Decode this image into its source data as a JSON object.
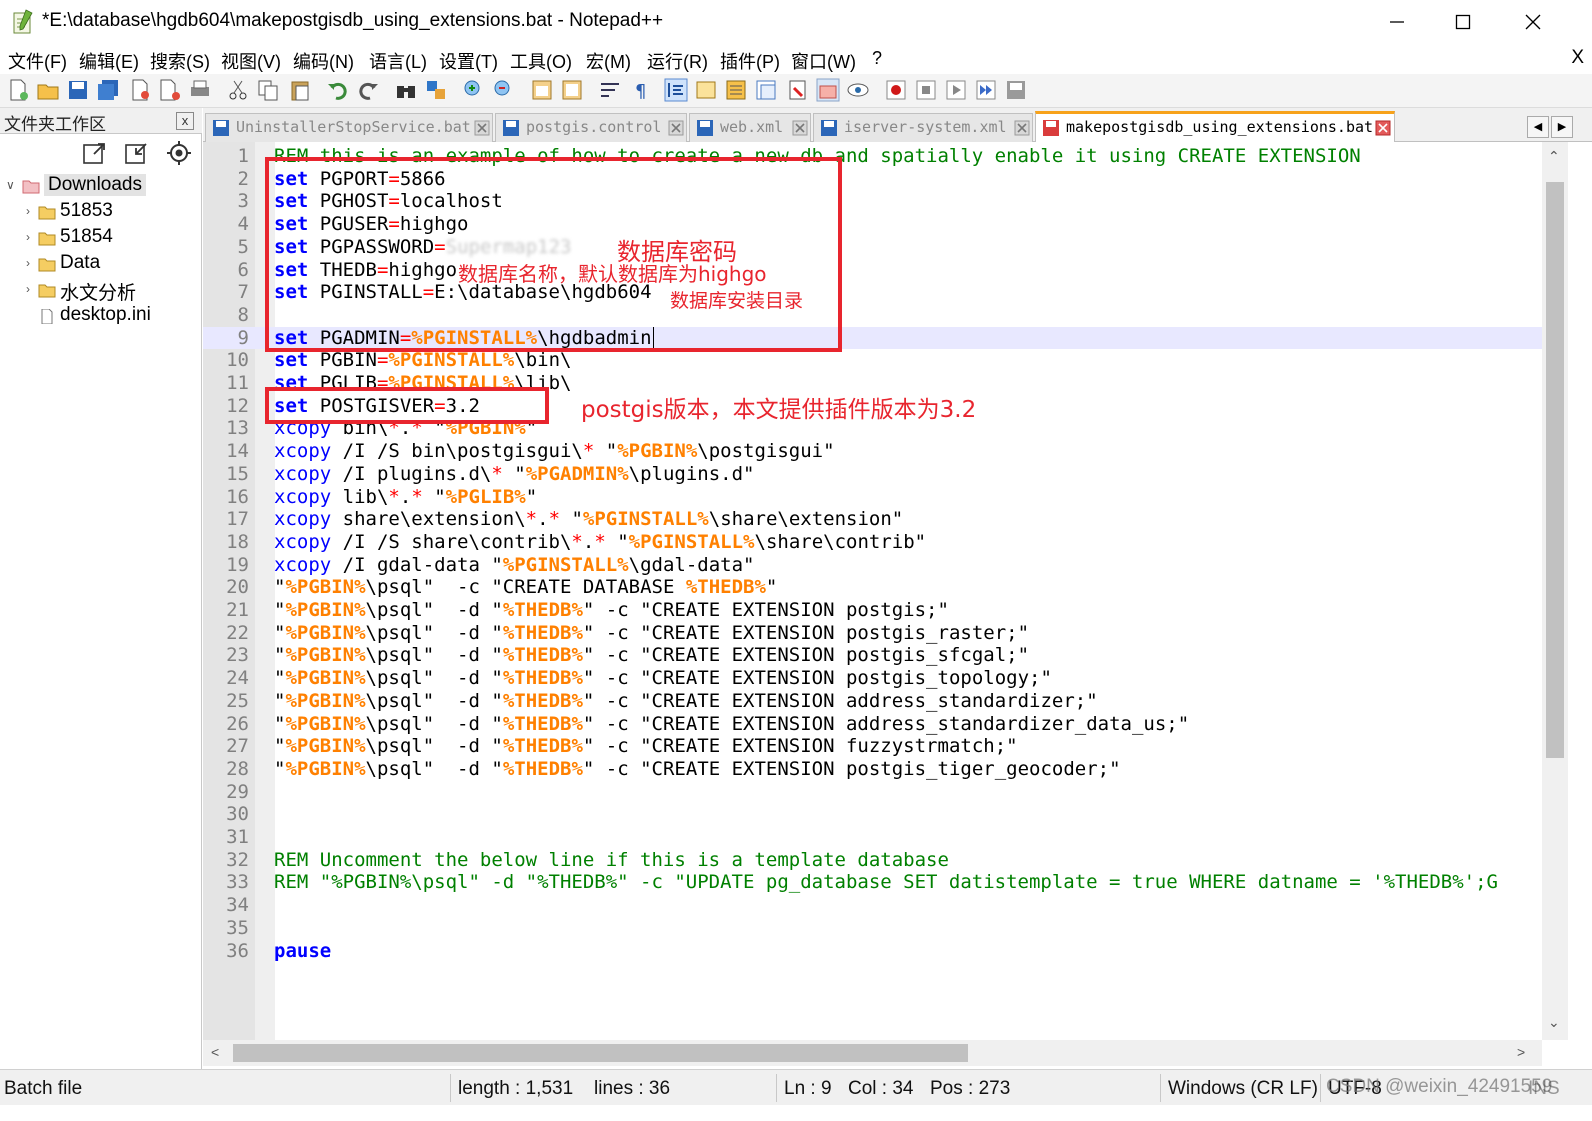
{
  "window": {
    "title": "*E:\\database\\hgdb604\\makepostgisdb_using_extensions.bat - Notepad++",
    "min_icon": "minimize-icon",
    "max_icon": "maximize-icon",
    "close_icon": "close-icon"
  },
  "menu": {
    "items": [
      "文件(F)",
      "编辑(E)",
      "搜索(S)",
      "视图(V)",
      "编码(N)",
      "语言(L)",
      "设置(T)",
      "工具(O)",
      "宏(M)",
      "运行(R)",
      "插件(P)",
      "窗口(W)",
      "?"
    ],
    "close_label": "X"
  },
  "panel": {
    "title": "文件夹工作区",
    "close_label": "x",
    "tree": [
      {
        "label": "Downloads",
        "kind": "root"
      },
      {
        "label": "51853",
        "kind": "folder"
      },
      {
        "label": "51854",
        "kind": "folder"
      },
      {
        "label": "Data",
        "kind": "folder"
      },
      {
        "label": "水文分析",
        "kind": "folder"
      },
      {
        "label": "desktop.ini",
        "kind": "file"
      }
    ]
  },
  "tabs": [
    {
      "label": "UninstallerStopService.bat",
      "active": false
    },
    {
      "label": "postgis.control",
      "active": false
    },
    {
      "label": "web.xml",
      "active": false
    },
    {
      "label": "iserver-system.xml",
      "active": false
    },
    {
      "label": "makepostgisdb_using_extensions.bat",
      "active": true
    }
  ],
  "editor": {
    "current_line": 9,
    "lines": [
      {
        "n": "1",
        "segs": [
          [
            "c",
            "REM this is an example of how to create a new db and spatially enable it using CREATE EXTENSION"
          ]
        ]
      },
      {
        "n": "2",
        "segs": [
          [
            "k",
            "set"
          ],
          [
            "d",
            " PGPORT"
          ],
          [
            "op",
            "="
          ],
          [
            "d",
            "5866"
          ]
        ]
      },
      {
        "n": "3",
        "segs": [
          [
            "k",
            "set"
          ],
          [
            "d",
            " PGHOST"
          ],
          [
            "op",
            "="
          ],
          [
            "d",
            "localhost"
          ]
        ]
      },
      {
        "n": "4",
        "segs": [
          [
            "k",
            "set"
          ],
          [
            "d",
            " PGUSER"
          ],
          [
            "op",
            "="
          ],
          [
            "d",
            "highgo"
          ]
        ]
      },
      {
        "n": "5",
        "segs": [
          [
            "k",
            "set"
          ],
          [
            "d",
            " PGPASSWORD"
          ],
          [
            "op",
            "="
          ],
          [
            "blur",
            "Supermap123"
          ]
        ]
      },
      {
        "n": "6",
        "segs": [
          [
            "k",
            "set"
          ],
          [
            "d",
            " THEDB"
          ],
          [
            "op",
            "="
          ],
          [
            "d",
            "highgo"
          ]
        ]
      },
      {
        "n": "7",
        "segs": [
          [
            "k",
            "set"
          ],
          [
            "d",
            " PGINSTALL"
          ],
          [
            "op",
            "="
          ],
          [
            "d",
            "E:\\database\\hgdb604"
          ]
        ]
      },
      {
        "n": "8",
        "segs": []
      },
      {
        "n": "9",
        "segs": [
          [
            "k",
            "set"
          ],
          [
            "d",
            " PGADMIN"
          ],
          [
            "op",
            "="
          ],
          [
            "v",
            "%PGINSTALL%"
          ],
          [
            "d",
            "\\hgdbadmin"
          ]
        ]
      },
      {
        "n": "10",
        "segs": [
          [
            "k",
            "set"
          ],
          [
            "d",
            " PGBIN"
          ],
          [
            "op",
            "="
          ],
          [
            "v",
            "%PGINSTALL%"
          ],
          [
            "d",
            "\\bin\\"
          ]
        ]
      },
      {
        "n": "11",
        "segs": [
          [
            "k",
            "set"
          ],
          [
            "d",
            " PGLIB"
          ],
          [
            "op",
            "="
          ],
          [
            "v",
            "%PGINSTALL%"
          ],
          [
            "d",
            "\\lib\\"
          ]
        ]
      },
      {
        "n": "12",
        "segs": [
          [
            "k",
            "set"
          ],
          [
            "d",
            " POSTGISVER"
          ],
          [
            "op",
            "="
          ],
          [
            "d",
            "3.2"
          ]
        ]
      },
      {
        "n": "13",
        "segs": [
          [
            "x",
            "xcopy"
          ],
          [
            "d",
            " bin\\"
          ],
          [
            "op",
            "*"
          ],
          [
            "d",
            "."
          ],
          [
            "op",
            "*"
          ],
          [
            "d",
            " \""
          ],
          [
            "v",
            "%PGBIN%"
          ],
          [
            "d",
            "\""
          ]
        ]
      },
      {
        "n": "14",
        "segs": [
          [
            "x",
            "xcopy"
          ],
          [
            "d",
            " /I /S bin\\postgisgui\\"
          ],
          [
            "op",
            "*"
          ],
          [
            "d",
            " \""
          ],
          [
            "v",
            "%PGBIN%"
          ],
          [
            "d",
            "\\postgisgui\""
          ]
        ]
      },
      {
        "n": "15",
        "segs": [
          [
            "x",
            "xcopy"
          ],
          [
            "d",
            " /I plugins.d\\"
          ],
          [
            "op",
            "*"
          ],
          [
            "d",
            " \""
          ],
          [
            "v",
            "%PGADMIN%"
          ],
          [
            "d",
            "\\plugins.d\""
          ]
        ]
      },
      {
        "n": "16",
        "segs": [
          [
            "x",
            "xcopy"
          ],
          [
            "d",
            " lib\\"
          ],
          [
            "op",
            "*"
          ],
          [
            "d",
            "."
          ],
          [
            "op",
            "*"
          ],
          [
            "d",
            " \""
          ],
          [
            "v",
            "%PGLIB%"
          ],
          [
            "d",
            "\""
          ]
        ]
      },
      {
        "n": "17",
        "segs": [
          [
            "x",
            "xcopy"
          ],
          [
            "d",
            " share\\extension\\"
          ],
          [
            "op",
            "*"
          ],
          [
            "d",
            "."
          ],
          [
            "op",
            "*"
          ],
          [
            "d",
            " \""
          ],
          [
            "v",
            "%PGINSTALL%"
          ],
          [
            "d",
            "\\share\\extension\""
          ]
        ]
      },
      {
        "n": "18",
        "segs": [
          [
            "x",
            "xcopy"
          ],
          [
            "d",
            " /I /S share\\contrib\\"
          ],
          [
            "op",
            "*"
          ],
          [
            "d",
            "."
          ],
          [
            "op",
            "*"
          ],
          [
            "d",
            " \""
          ],
          [
            "v",
            "%PGINSTALL%"
          ],
          [
            "d",
            "\\share\\contrib\""
          ]
        ]
      },
      {
        "n": "19",
        "segs": [
          [
            "x",
            "xcopy"
          ],
          [
            "d",
            " /I gdal-data \""
          ],
          [
            "v",
            "%PGINSTALL%"
          ],
          [
            "d",
            "\\gdal-data\""
          ]
        ]
      },
      {
        "n": "20",
        "segs": [
          [
            "d",
            "\""
          ],
          [
            "v",
            "%PGBIN%"
          ],
          [
            "d",
            "\\psql\"  -c \"CREATE DATABASE "
          ],
          [
            "v",
            "%THEDB%"
          ],
          [
            "d",
            "\""
          ]
        ]
      },
      {
        "n": "21",
        "segs": [
          [
            "d",
            "\""
          ],
          [
            "v",
            "%PGBIN%"
          ],
          [
            "d",
            "\\psql\"  -d \""
          ],
          [
            "v",
            "%THEDB%"
          ],
          [
            "d",
            "\" -c \"CREATE EXTENSION postgis;\""
          ]
        ]
      },
      {
        "n": "22",
        "segs": [
          [
            "d",
            "\""
          ],
          [
            "v",
            "%PGBIN%"
          ],
          [
            "d",
            "\\psql\"  -d \""
          ],
          [
            "v",
            "%THEDB%"
          ],
          [
            "d",
            "\" -c \"CREATE EXTENSION postgis_raster;\""
          ]
        ]
      },
      {
        "n": "23",
        "segs": [
          [
            "d",
            "\""
          ],
          [
            "v",
            "%PGBIN%"
          ],
          [
            "d",
            "\\psql\"  -d \""
          ],
          [
            "v",
            "%THEDB%"
          ],
          [
            "d",
            "\" -c \"CREATE EXTENSION postgis_sfcgal;\""
          ]
        ]
      },
      {
        "n": "24",
        "segs": [
          [
            "d",
            "\""
          ],
          [
            "v",
            "%PGBIN%"
          ],
          [
            "d",
            "\\psql\"  -d \""
          ],
          [
            "v",
            "%THEDB%"
          ],
          [
            "d",
            "\" -c \"CREATE EXTENSION postgis_topology;\""
          ]
        ]
      },
      {
        "n": "25",
        "segs": [
          [
            "d",
            "\""
          ],
          [
            "v",
            "%PGBIN%"
          ],
          [
            "d",
            "\\psql\"  -d \""
          ],
          [
            "v",
            "%THEDB%"
          ],
          [
            "d",
            "\" -c \"CREATE EXTENSION address_standardizer;\""
          ]
        ]
      },
      {
        "n": "26",
        "segs": [
          [
            "d",
            "\""
          ],
          [
            "v",
            "%PGBIN%"
          ],
          [
            "d",
            "\\psql\"  -d \""
          ],
          [
            "v",
            "%THEDB%"
          ],
          [
            "d",
            "\" -c \"CREATE EXTENSION address_standardizer_data_us;\""
          ]
        ]
      },
      {
        "n": "27",
        "segs": [
          [
            "d",
            "\""
          ],
          [
            "v",
            "%PGBIN%"
          ],
          [
            "d",
            "\\psql\"  -d \""
          ],
          [
            "v",
            "%THEDB%"
          ],
          [
            "d",
            "\" -c \"CREATE EXTENSION fuzzystrmatch;\""
          ]
        ]
      },
      {
        "n": "28",
        "segs": [
          [
            "d",
            "\""
          ],
          [
            "v",
            "%PGBIN%"
          ],
          [
            "d",
            "\\psql\"  -d \""
          ],
          [
            "v",
            "%THEDB%"
          ],
          [
            "d",
            "\" -c \"CREATE EXTENSION postgis_tiger_geocoder;\""
          ]
        ]
      },
      {
        "n": "29",
        "segs": []
      },
      {
        "n": "30",
        "segs": []
      },
      {
        "n": "31",
        "segs": []
      },
      {
        "n": "32",
        "segs": [
          [
            "c",
            "REM Uncomment the below line if this is a template database"
          ]
        ]
      },
      {
        "n": "33",
        "segs": [
          [
            "c",
            "REM \"%PGBIN%\\psql\" -d \"%THEDB%\" -c \"UPDATE pg_database SET datistemplate = true WHERE datname = '%THEDB%';G"
          ]
        ]
      },
      {
        "n": "34",
        "segs": []
      },
      {
        "n": "35",
        "segs": []
      },
      {
        "n": "36",
        "segs": [
          [
            "k",
            "pause"
          ]
        ]
      }
    ]
  },
  "annotations": {
    "password": "数据库密码",
    "dbname": "数据库名称，默认数据库为highgo",
    "install": "数据库安装目录",
    "postgis": "postgis版本，本文提供插件版本为3.2"
  },
  "status": {
    "file_type": "Batch file",
    "length": "length : 1,531",
    "lines": "lines : 36",
    "ln": "Ln : 9",
    "col": "Col : 34",
    "pos": "Pos : 273",
    "eol": "Windows (CR LF)",
    "encoding": "UTF-8",
    "watermark": "CSDN @weixin_42491559",
    "ins": "INS"
  },
  "colors": {
    "keyword": "#0000ff",
    "comment": "#008000",
    "variable": "#ff8000",
    "operator": "#ff0000",
    "annotation": "#e8252e",
    "tab_accent": "#f7a21b"
  }
}
